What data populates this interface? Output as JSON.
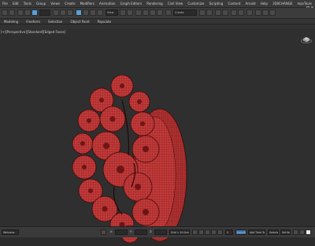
{
  "menu": [
    "File",
    "Edit",
    "Tools",
    "Group",
    "Views",
    "Create",
    "Modifiers",
    "Animation",
    "Graph Editors",
    "Rendering",
    "Civil View",
    "Customize",
    "Scripting",
    "Content",
    "Arnold",
    "Help",
    "3DXCHANGE",
    "mpsTools"
  ],
  "ribbon": {
    "tabs": [
      "Modeling",
      "Freeform",
      "Selection",
      "Object Paint",
      "Populate"
    ]
  },
  "toolbar": {
    "view_field": "View",
    "selection_set_field": "Create Selection Se"
  },
  "viewport": {
    "label": "[+][Perspective][Standard][Edged Faces]",
    "object": "flower wreath mesh"
  },
  "status": {
    "left_text": "Welcome",
    "grid_text": "Grid = 10.0cm",
    "key_text": "Add Time Tag",
    "auto_key": "Auto Key",
    "set_key": "Set Key",
    "selected": "Selected",
    "frame": "0",
    "x": "X:",
    "y": "Y:",
    "z": "Z:"
  },
  "colors": {
    "model": "#c23a3a",
    "wire": "#5a0f0f",
    "viewport_bg": "#2f2f2f"
  }
}
